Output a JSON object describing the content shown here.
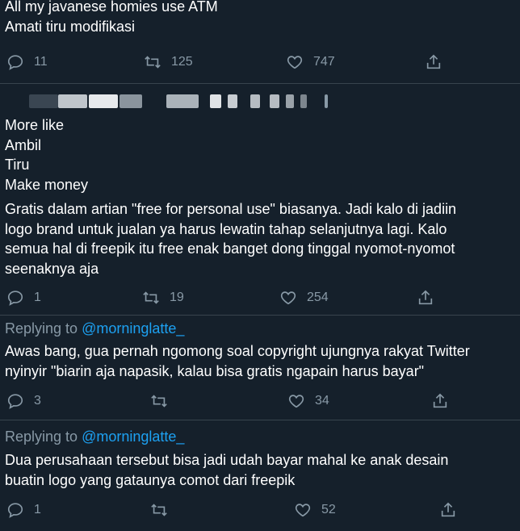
{
  "tweets": [
    {
      "body": "All my javanese homies use ATM\nAmati tiru modifikasi",
      "replies": "11",
      "retweets": "125",
      "likes": "747"
    },
    {
      "body": "More like\nAmbil\nTiru\nMake money",
      "quote": "Gratis dalam artian \"free for personal use\" biasanya. Jadi kalo di jadiin\nlogo brand untuk jualan ya harus lewatin tahap selanjutnya lagi. Kalo\nsemua hal di freepik itu free enak banget dong tinggal nyomot-nyomot\nseenaknya aja",
      "replies": "1",
      "retweets": "19",
      "likes": "254"
    },
    {
      "replying_label": "Replying to",
      "replying_handle": "@morninglatte_",
      "body": "Awas bang, gua pernah ngomong soal copyright ujungnya rakyat Twitter\nnyinyir \"biarin aja napasik, kalau bisa gratis ngapain harus bayar\"",
      "replies": "3",
      "retweets": "",
      "likes": "34"
    },
    {
      "replying_label": "Replying to",
      "replying_handle": "@morninglatte_",
      "body": "Dua perusahaan tersebut bisa jadi udah bayar mahal ke anak desain\nbuatin logo yang gataunya comot dari freepik",
      "replies": "1",
      "retweets": "",
      "likes": "52"
    }
  ],
  "colors": {
    "background": "#15202b",
    "muted": "#8899a6",
    "link": "#1da1f2",
    "divider": "#38444d"
  },
  "icons": [
    "reply-icon",
    "retweet-icon",
    "like-icon",
    "share-icon"
  ]
}
